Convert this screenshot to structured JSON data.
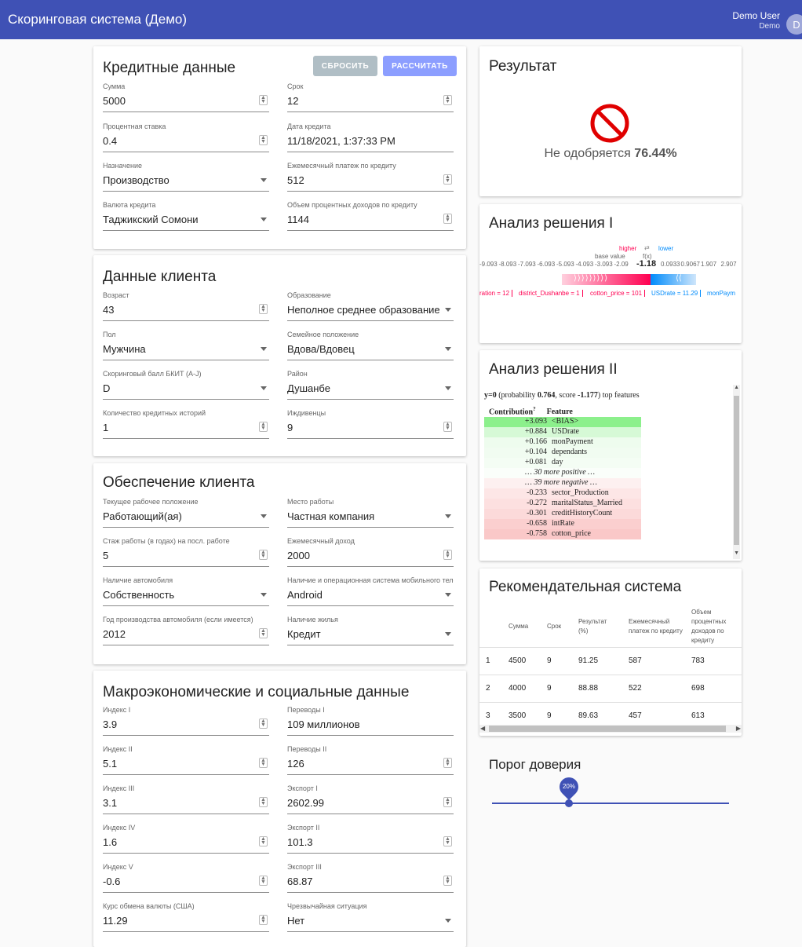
{
  "app": {
    "title": "Скоринговая система (Демо)",
    "user_name": "Demo User",
    "user_role": "Demo",
    "avatar": "D"
  },
  "credit": {
    "title": "Кредитные данные",
    "reset": "СБРОСИТЬ",
    "calc": "РАССЧИТАТЬ",
    "sum_l": "Сумма",
    "sum_v": "5000",
    "term_l": "Срок",
    "term_v": "12",
    "rate_l": "Процентная ставка",
    "rate_v": "0.4",
    "date_l": "Дата кредита",
    "date_v": "11/18/2021, 1:37:33 PM",
    "purpose_l": "Назначение",
    "purpose_v": "Производство",
    "monthly_l": "Ежемесячный платеж по кредиту",
    "monthly_v": "512",
    "currency_l": "Валюта кредита",
    "currency_v": "Таджикский Сомони",
    "income_l": "Объем процентных доходов по кредиту",
    "income_v": "1144"
  },
  "client": {
    "title": "Данные клиента",
    "age_l": "Возраст",
    "age_v": "43",
    "edu_l": "Образование",
    "edu_v": "Неполное среднее образование",
    "sex_l": "Пол",
    "sex_v": "Мужчина",
    "fam_l": "Семейное положение",
    "fam_v": "Вдова/Вдовец",
    "score_l": "Скоринговый балл БКИТ (A-J)",
    "score_v": "D",
    "district_l": "Район",
    "district_v": "Душанбе",
    "hist_l": "Количество кредитных историй",
    "hist_v": "1",
    "dep_l": "Иждивенцы",
    "dep_v": "9"
  },
  "security": {
    "title": "Обеспечение клиента",
    "work_l": "Текущее рабочее положение",
    "work_v": "Работающий(ая)",
    "place_l": "Место работы",
    "place_v": "Частная компания",
    "exp_l": "Стаж работы (в годах) на посл. работе",
    "exp_v": "5",
    "inc_l": "Ежемесячный доход",
    "inc_v": "2000",
    "car_l": "Наличие автомобиля",
    "car_v": "Собственность",
    "phone_l": "Наличие и операционная система мобильного теле...",
    "phone_v": "Android",
    "cary_l": "Год производства автомобиля (если имеется)",
    "cary_v": "2012",
    "house_l": "Наличие жилья",
    "house_v": "Кредит"
  },
  "macro": {
    "title": "Макроэкономические и социальные данные",
    "i1_l": "Индекс I",
    "i1_v": "3.9",
    "t1_l": "Переводы I",
    "t1_v": "109 миллионов",
    "i2_l": "Индекс II",
    "i2_v": "5.1",
    "t2_l": "Переводы II",
    "t2_v": "126",
    "i3_l": "Индекс III",
    "i3_v": "3.1",
    "e1_l": "Экспорт I",
    "e1_v": "2602.99",
    "i4_l": "Индекс IV",
    "i4_v": "1.6",
    "e2_l": "Экспорт II",
    "e2_v": "101.3",
    "i5_l": "Индекс V",
    "i5_v": "-0.6",
    "e3_l": "Экспорт III",
    "e3_v": "68.87",
    "fx_l": "Курс обмена валюты (США)",
    "fx_v": "11.29",
    "em_l": "Чрезвычайная ситуация",
    "em_v": "Нет"
  },
  "result": {
    "title": "Результат",
    "text": "Не одобряется",
    "pct": "76.44%"
  },
  "analysis1": {
    "title": "Анализ решения I",
    "higher": "higher",
    "lower": "lower",
    "base": "base value",
    "fx": "f(x)",
    "axis": [
      "-9.093",
      "-8.093",
      "-7.093",
      "-6.093",
      "-5.093",
      "-4.093",
      "-3.093",
      "-2.09"
    ],
    "fval": "-1.18",
    "axis2": [
      "0.0933",
      "0.9067",
      "1.907",
      "2.907"
    ],
    "f1": "ration = 12",
    "f2": "district_Dushanbe = 1",
    "f3": "cotton_price = 101",
    "f4": "USDrate = 11.29",
    "f5": "monPaym"
  },
  "analysis2": {
    "title": "Анализ решения II",
    "h_y": "y=0",
    "h_p1": " (probability ",
    "h_prob": "0.764",
    "h_s": ", score ",
    "h_score": "-1.177",
    "h_e": ") top features",
    "col1": "Contribution",
    "col2": "Feature",
    "rows": [
      [
        "+3.093",
        "<BIAS>"
      ],
      [
        "+0.884",
        "USDrate"
      ],
      [
        "+0.166",
        "monPayment"
      ],
      [
        "+0.104",
        "dependants"
      ],
      [
        "+0.081",
        "day"
      ],
      [
        "",
        "… 30 more positive …"
      ],
      [
        "",
        "… 39 more negative …"
      ],
      [
        "-0.233",
        "sector_Production"
      ],
      [
        "-0.272",
        "maritalStatus_Married"
      ],
      [
        "-0.301",
        "creditHistoryCount"
      ],
      [
        "-0.658",
        "intRate"
      ],
      [
        "-0.758",
        "cotton_price"
      ]
    ]
  },
  "recommend": {
    "title": "Рекомендательная система",
    "headers": [
      "Сумма",
      "Срок",
      "Результат (%)",
      "Ежемесячный платеж по кредиту",
      "Объем процентных доходов по кредиту"
    ],
    "rows": [
      [
        "1",
        "4500",
        "9",
        "91.25",
        "587",
        "783"
      ],
      [
        "2",
        "4000",
        "9",
        "88.88",
        "522",
        "698"
      ],
      [
        "3",
        "3500",
        "9",
        "89.63",
        "457",
        "613"
      ]
    ]
  },
  "threshold": {
    "title": "Порог доверия",
    "value": "20%",
    "fraction": 0.2
  },
  "colors": {
    "primary": "#3f51b5",
    "positive": "#ff0051",
    "negative": "#008bfb"
  }
}
